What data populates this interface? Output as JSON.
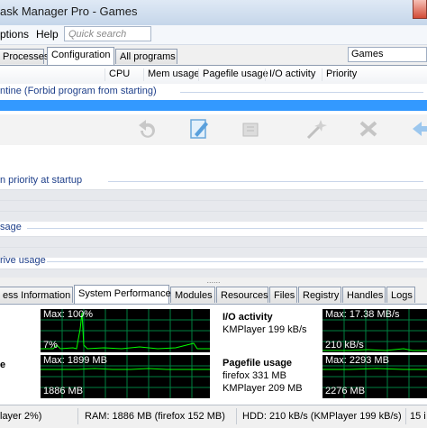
{
  "window": {
    "title": "ask Manager Pro - Games"
  },
  "menu": {
    "options": "ptions",
    "help": "Help",
    "quick_search_placeholder": "Quick search"
  },
  "top_tabs": [
    "Processes",
    "Configuration",
    "All programs"
  ],
  "active_top_tab": "Configuration",
  "filter_value": "Games",
  "columns": [
    "CPU",
    "Mem usage",
    "Pagefile usage",
    "I/O activity",
    "Priority"
  ],
  "groups": {
    "quarantine": "ntine (Forbid program from starting)",
    "priority": "n priority at startup",
    "usage": "sage",
    "drive_usage": "rive usage"
  },
  "splitter_handle": "......",
  "bottom_tabs": [
    "ess Information",
    "System Performance",
    "Modules",
    "Resources",
    "Files",
    "Registry",
    "Handles",
    "Logs"
  ],
  "active_bottom_tab": "System Performance",
  "performance": {
    "cpu_graph": {
      "max": "Max: 100%",
      "current": "7%"
    },
    "io_label": "I/O activity",
    "io_detail": "KMPlayer 199 kB/s",
    "io_graph": {
      "max": "Max: 17.38 MB/s",
      "current": "210 kB/s"
    },
    "mem_label": "e",
    "mem_graph": {
      "max": "Max: 1899 MB",
      "current": "1886 MB"
    },
    "pagefile_label": "Pagefile usage",
    "pagefile_detail_1": "firefox 331 MB",
    "pagefile_detail_2": "KMPlayer 209 MB",
    "pagefile_graph": {
      "max": "Max: 2293 MB",
      "current": "2276 MB"
    }
  },
  "status": {
    "cpu": "layer 2%)",
    "ram": "RAM: 1886 MB (firefox 152 MB)",
    "hdd": "HDD: 210 kB/s (KMPlayer 199 kB/s)",
    "extra": "15 i"
  },
  "colors": {
    "graph_bg": "#000000",
    "graph_line": "#00ff00",
    "grid": "#008040",
    "selection": "#3399ff",
    "group_text": "#1e3f8a"
  }
}
